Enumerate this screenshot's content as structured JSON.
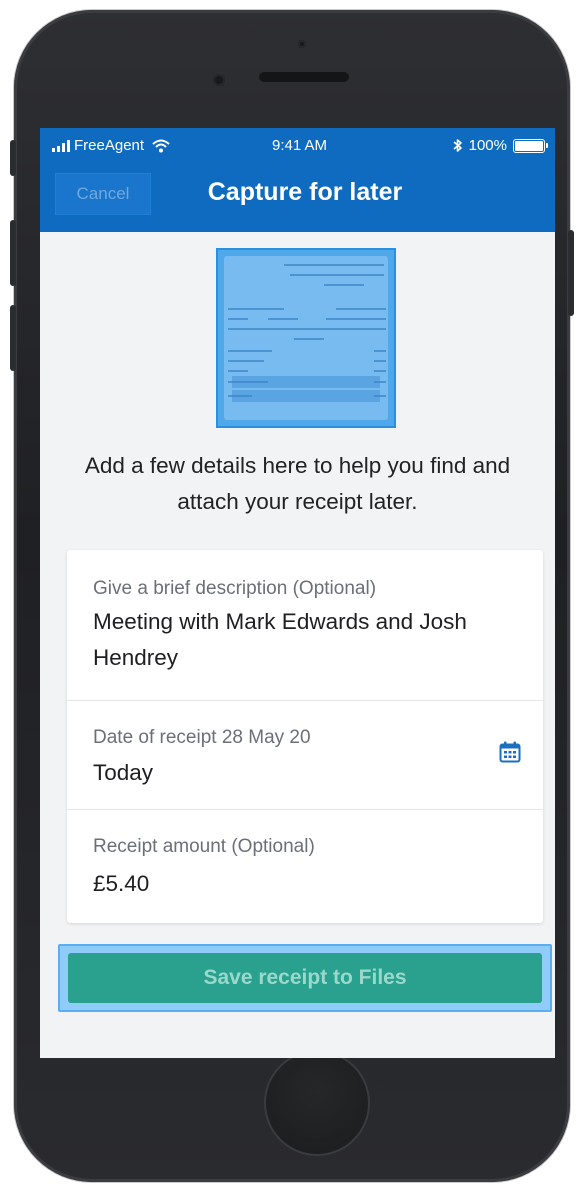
{
  "status_bar": {
    "carrier": "FreeAgent",
    "time": "9:41 AM",
    "battery": "100%"
  },
  "nav": {
    "cancel_label": "Cancel",
    "title": "Capture for later"
  },
  "intro_text": "Add a few details here to help you find and attach your receipt later.",
  "form": {
    "description": {
      "label": "Give a brief description (Optional)",
      "value": "Meeting with Mark Edwards and Josh Hendrey"
    },
    "date": {
      "label": "Date of receipt 28 May 20",
      "value": "Today"
    },
    "amount": {
      "label": "Receipt amount (Optional)",
      "value": "£5.40"
    }
  },
  "save_label": "Save receipt to Files",
  "icons": {
    "calendar": "calendar-icon",
    "wifi": "wifi-icon",
    "bluetooth": "bluetooth-icon",
    "signal": "signal-icon",
    "battery": "battery-icon"
  },
  "colors": {
    "nav_blue": "#0f6bbf",
    "save_teal": "#2aa18e",
    "icon_blue": "#1a6fc0"
  }
}
